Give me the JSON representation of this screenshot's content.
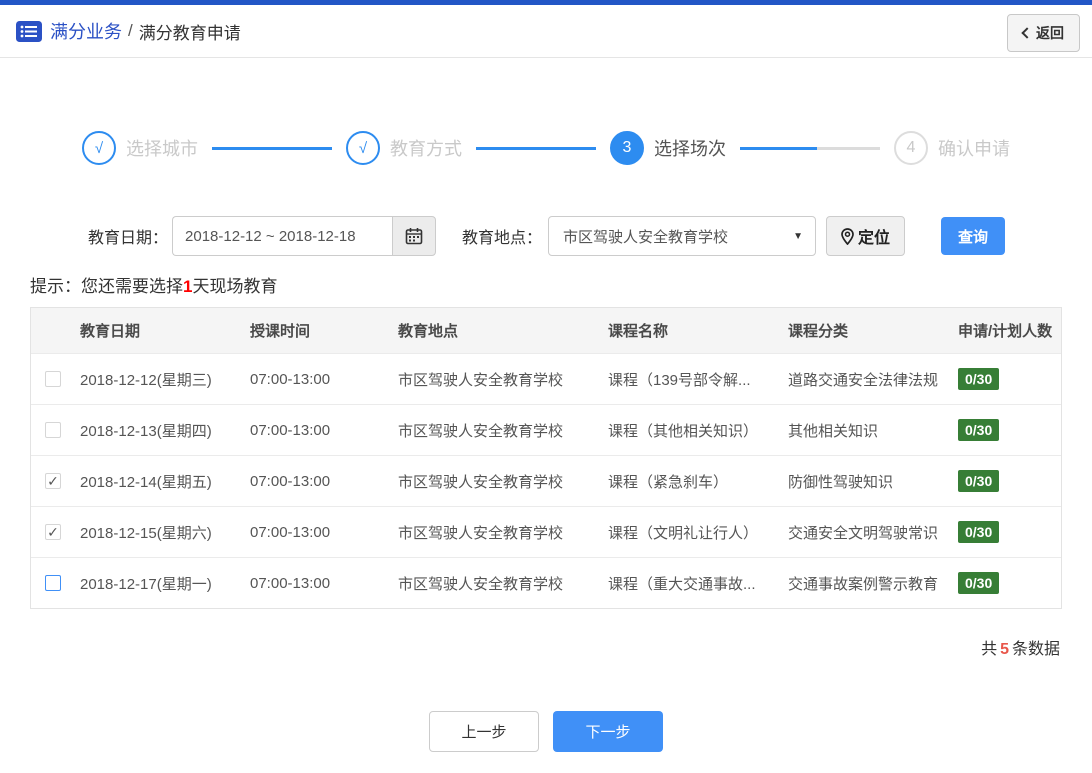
{
  "header": {
    "breadcrumb_section": "满分业务",
    "breadcrumb_separator": "/",
    "breadcrumb_page": "满分教育申请",
    "back_button": "返回"
  },
  "steps": {
    "items": [
      {
        "mark": "√",
        "label": "选择城市",
        "state": "done"
      },
      {
        "mark": "√",
        "label": "教育方式",
        "state": "done"
      },
      {
        "mark": "3",
        "label": "选择场次",
        "state": "active"
      },
      {
        "mark": "4",
        "label": "确认申请",
        "state": "pending"
      }
    ]
  },
  "filters": {
    "date_label": "教育日期：",
    "date_value": "2018-12-12 ~ 2018-12-18",
    "location_label": "教育地点：",
    "location_value": "市区驾驶人安全教育学校",
    "caret": "▼",
    "locate_button": "定位",
    "search_button": "查询"
  },
  "notice": {
    "prefix": "提示：您还需要选择",
    "highlight": "1",
    "suffix": "天现场教育"
  },
  "table": {
    "headers": [
      "教育日期",
      "授课时间",
      "教育地点",
      "课程名称",
      "课程分类",
      "申请/计划人数"
    ],
    "rows": [
      {
        "checkbox_state": "unchecked",
        "date": "2018-12-12(星期三)",
        "time": "07:00-13:00",
        "location": "市区驾驶人安全教育学校",
        "course": "课程（139号部令解...",
        "category": "道路交通安全法律法规",
        "quota": "0/30"
      },
      {
        "checkbox_state": "unchecked",
        "date": "2018-12-13(星期四)",
        "time": "07:00-13:00",
        "location": "市区驾驶人安全教育学校",
        "course": "课程（其他相关知识）",
        "category": "其他相关知识",
        "quota": "0/30"
      },
      {
        "checkbox_state": "checked",
        "date": "2018-12-14(星期五)",
        "time": "07:00-13:00",
        "location": "市区驾驶人安全教育学校",
        "course": "课程（紧急刹车）",
        "category": "防御性驾驶知识",
        "quota": "0/30"
      },
      {
        "checkbox_state": "checked",
        "date": "2018-12-15(星期六)",
        "time": "07:00-13:00",
        "location": "市区驾驶人安全教育学校",
        "course": "课程（文明礼让行人）",
        "category": "交通安全文明驾驶常识",
        "quota": "0/30"
      },
      {
        "checkbox_state": "unchecked-focus",
        "date": "2018-12-17(星期一)",
        "time": "07:00-13:00",
        "location": "市区驾驶人安全教育学校",
        "course": "课程（重大交通事故...",
        "category": "交通事故案例警示教育",
        "quota": "0/30"
      }
    ]
  },
  "summary": {
    "prefix": "共",
    "count": "5",
    "suffix": "条数据"
  },
  "footer": {
    "prev_button": "上一步",
    "next_button": "下一步"
  },
  "colors": {
    "topbar_blue": "#2256c6",
    "breadcrumb_blue": "#2b51c5",
    "step_blue": "#2d8cf0",
    "primary_button_blue": "#4090f7",
    "badge_green": "#377e36",
    "notice_red": "#ff0000",
    "count_red": "#e8564a"
  }
}
